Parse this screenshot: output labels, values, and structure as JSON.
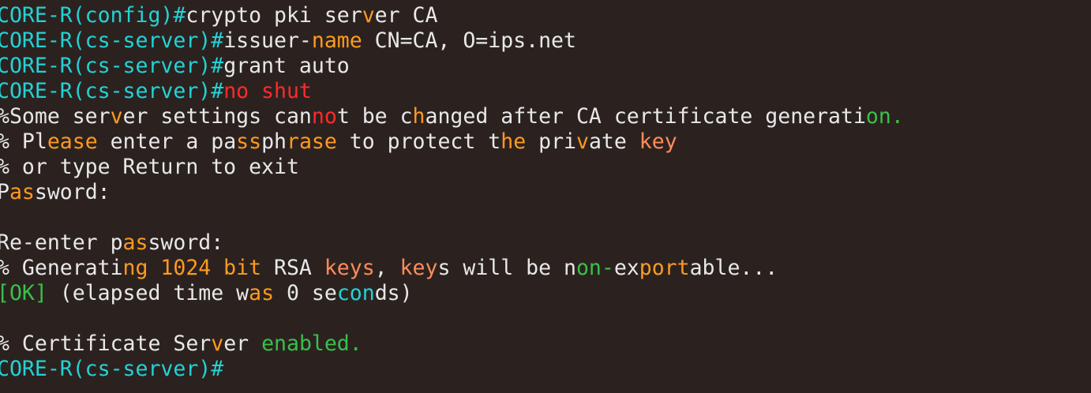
{
  "terminal": {
    "lines": [
      {
        "name": "line-top-cut",
        "segments": []
      },
      {
        "name": "line-crypto-pki-server",
        "segments": [
          {
            "text": "CORE-R(config)#",
            "cls": "prompt"
          },
          {
            "text": "crypto pki ser",
            "cls": "plain"
          },
          {
            "text": "v",
            "cls": "kw-orange"
          },
          {
            "text": "er CA",
            "cls": "plain"
          }
        ]
      },
      {
        "name": "line-issuer-name",
        "segments": [
          {
            "text": "CORE-R(cs-server)#",
            "cls": "prompt"
          },
          {
            "text": "issuer-",
            "cls": "plain"
          },
          {
            "text": "name",
            "cls": "kw-orange"
          },
          {
            "text": " CN=CA, O=ips.net",
            "cls": "plain"
          }
        ]
      },
      {
        "name": "line-grant-auto",
        "segments": [
          {
            "text": "CORE-R(cs-server)#",
            "cls": "prompt"
          },
          {
            "text": "grant auto",
            "cls": "plain"
          }
        ]
      },
      {
        "name": "line-no-shut",
        "segments": [
          {
            "text": "CORE-R(cs-server)#",
            "cls": "prompt"
          },
          {
            "text": "no shut",
            "cls": "kw-red"
          }
        ]
      },
      {
        "name": "line-settings-warning",
        "segments": [
          {
            "text": "%Some ser",
            "cls": "plain"
          },
          {
            "text": "v",
            "cls": "kw-orange"
          },
          {
            "text": "er settings can",
            "cls": "plain"
          },
          {
            "text": "no",
            "cls": "kw-red"
          },
          {
            "text": "t be c",
            "cls": "plain"
          },
          {
            "text": "h",
            "cls": "kw-orange"
          },
          {
            "text": "anged after CA certificate generati",
            "cls": "plain"
          },
          {
            "text": "on.",
            "cls": "kw-green"
          }
        ]
      },
      {
        "name": "line-passphrase-prompt",
        "segments": [
          {
            "text": "% Pl",
            "cls": "plain"
          },
          {
            "text": "ease",
            "cls": "kw-orange"
          },
          {
            "text": " enter a pa",
            "cls": "plain"
          },
          {
            "text": "ss",
            "cls": "kw-orange"
          },
          {
            "text": "ph",
            "cls": "plain"
          },
          {
            "text": "rase",
            "cls": "kw-orange"
          },
          {
            "text": " to protect t",
            "cls": "plain"
          },
          {
            "text": "he",
            "cls": "kw-orange"
          },
          {
            "text": " pri",
            "cls": "plain"
          },
          {
            "text": "v",
            "cls": "kw-orange"
          },
          {
            "text": "ate ",
            "cls": "plain"
          },
          {
            "text": "key",
            "cls": "kw-salmon"
          }
        ]
      },
      {
        "name": "line-or-return",
        "segments": [
          {
            "text": "% or type Return to exit",
            "cls": "plain"
          }
        ]
      },
      {
        "name": "line-password",
        "segments": [
          {
            "text": "P",
            "cls": "plain"
          },
          {
            "text": "as",
            "cls": "kw-orange"
          },
          {
            "text": "sword:",
            "cls": "plain"
          }
        ]
      },
      {
        "name": "line-blank-1",
        "segments": []
      },
      {
        "name": "line-reenter-password",
        "segments": [
          {
            "text": "Re-enter p",
            "cls": "plain"
          },
          {
            "text": "as",
            "cls": "kw-orange"
          },
          {
            "text": "sword:",
            "cls": "plain"
          }
        ]
      },
      {
        "name": "line-generating-keys",
        "segments": [
          {
            "text": "% Generati",
            "cls": "plain"
          },
          {
            "text": "ng 1024 bit",
            "cls": "kw-orange"
          },
          {
            "text": " RSA ",
            "cls": "plain"
          },
          {
            "text": "keys",
            "cls": "kw-salmon"
          },
          {
            "text": ", ",
            "cls": "plain"
          },
          {
            "text": "key",
            "cls": "kw-salmon"
          },
          {
            "text": "s will be n",
            "cls": "plain"
          },
          {
            "text": "on-",
            "cls": "kw-green"
          },
          {
            "text": "ex",
            "cls": "plain"
          },
          {
            "text": "port",
            "cls": "kw-orange"
          },
          {
            "text": "able...",
            "cls": "plain"
          }
        ]
      },
      {
        "name": "line-ok-elapsed",
        "segments": [
          {
            "text": "[OK]",
            "cls": "kw-green"
          },
          {
            "text": " (elapsed time w",
            "cls": "plain"
          },
          {
            "text": "as",
            "cls": "kw-orange"
          },
          {
            "text": " 0 se",
            "cls": "plain"
          },
          {
            "text": "con",
            "cls": "prompt"
          },
          {
            "text": "ds)",
            "cls": "plain"
          }
        ]
      },
      {
        "name": "line-blank-2",
        "segments": []
      },
      {
        "name": "line-cert-server-enabled",
        "segments": [
          {
            "text": "% Certificate Ser",
            "cls": "plain"
          },
          {
            "text": "v",
            "cls": "kw-orange"
          },
          {
            "text": "er ",
            "cls": "plain"
          },
          {
            "text": "enabled.",
            "cls": "kw-green"
          }
        ]
      },
      {
        "name": "line-final-prompt",
        "segments": [
          {
            "text": "CORE-R(cs-server)#",
            "cls": "prompt"
          }
        ]
      }
    ]
  },
  "colors": {
    "background": "#2b2220",
    "prompt": "#22d3d6",
    "plain": "#e8e8e8",
    "orange": "#ff9a1f",
    "red": "#ff2a2a",
    "green": "#39c04a",
    "salmon": "#ff8c5a"
  }
}
